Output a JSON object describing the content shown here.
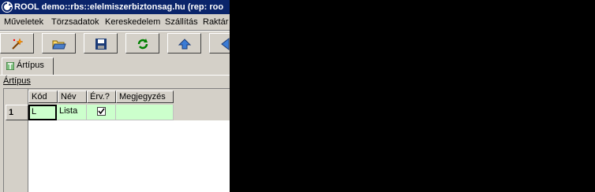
{
  "window": {
    "title": "ROOL demo::rbs::elelmiszerbiztonsag.hu (rep: roo"
  },
  "menubar": {
    "items": [
      "Műveletek",
      "Törzsadatok",
      "Kereskedelem",
      "Szállítás",
      "Raktár"
    ]
  },
  "toolbar": {
    "buttons": [
      "magic-wand-icon",
      "open-folder-icon",
      "save-icon",
      "refresh-icon",
      "up-arrow-icon",
      "back-arrow-icon"
    ]
  },
  "tabs": [
    {
      "label": "Ártípus",
      "active": true
    }
  ],
  "section": {
    "label": "Ártípus"
  },
  "grid": {
    "columns": [
      "Kód",
      "Név",
      "Érv.?",
      "Megjegyzés"
    ],
    "rows": [
      {
        "row_number": "1",
        "kod": "L",
        "nev": "Lista",
        "erv": true,
        "megjegyzes": ""
      }
    ],
    "row_color": "#ccffcc"
  },
  "colors": {
    "titlebar": "#0a246a",
    "chrome": "#d4d0c8",
    "background": "#000000"
  }
}
